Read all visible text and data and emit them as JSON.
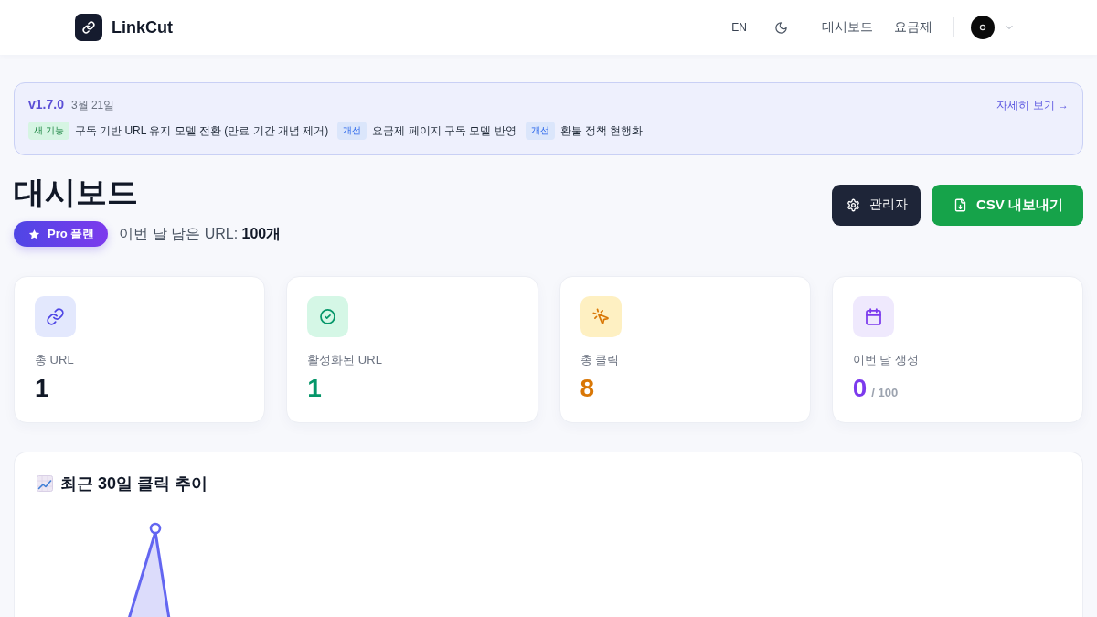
{
  "header": {
    "logo": "LinkCut",
    "language": "EN",
    "nav": [
      "대시보드",
      "요금제"
    ]
  },
  "release": {
    "version": "v1.7.0",
    "date": "3월 21일",
    "link": "자세히 보기 →",
    "items": [
      {
        "kind": "new",
        "tag": "새 기능",
        "text": "구독 기반 URL 유지 모델 전환 (만료 기간 개념 제거)"
      },
      {
        "kind": "improvement",
        "tag": "개선",
        "text": "요금제 페이지 구독 모델 반영"
      },
      {
        "kind": "improvement",
        "tag": "개선",
        "text": "환불 정책 현행화"
      }
    ]
  },
  "dashboard": {
    "title": "대시보드",
    "plan": "Pro 플랜",
    "quota": "이번 달 남은 URL: **100개**",
    "buttons": [
      {
        "kind": "admin",
        "label": "관리자"
      },
      {
        "kind": "export",
        "label": "CSV 내보내기"
      }
    ]
  },
  "stats": [
    {
      "kind": "total_urls",
      "label": "총 URL",
      "value": "1"
    },
    {
      "kind": "active_urls",
      "label": "활성화된 URL",
      "value": "1"
    },
    {
      "kind": "total_clicks",
      "label": "총 클릭",
      "value": "8"
    },
    {
      "kind": "monthly_created",
      "label": "이번 달 생성",
      "value": "0",
      "total": "/ 100"
    }
  ],
  "chart": {
    "title": "최근 30일 클릭 추이"
  }
}
